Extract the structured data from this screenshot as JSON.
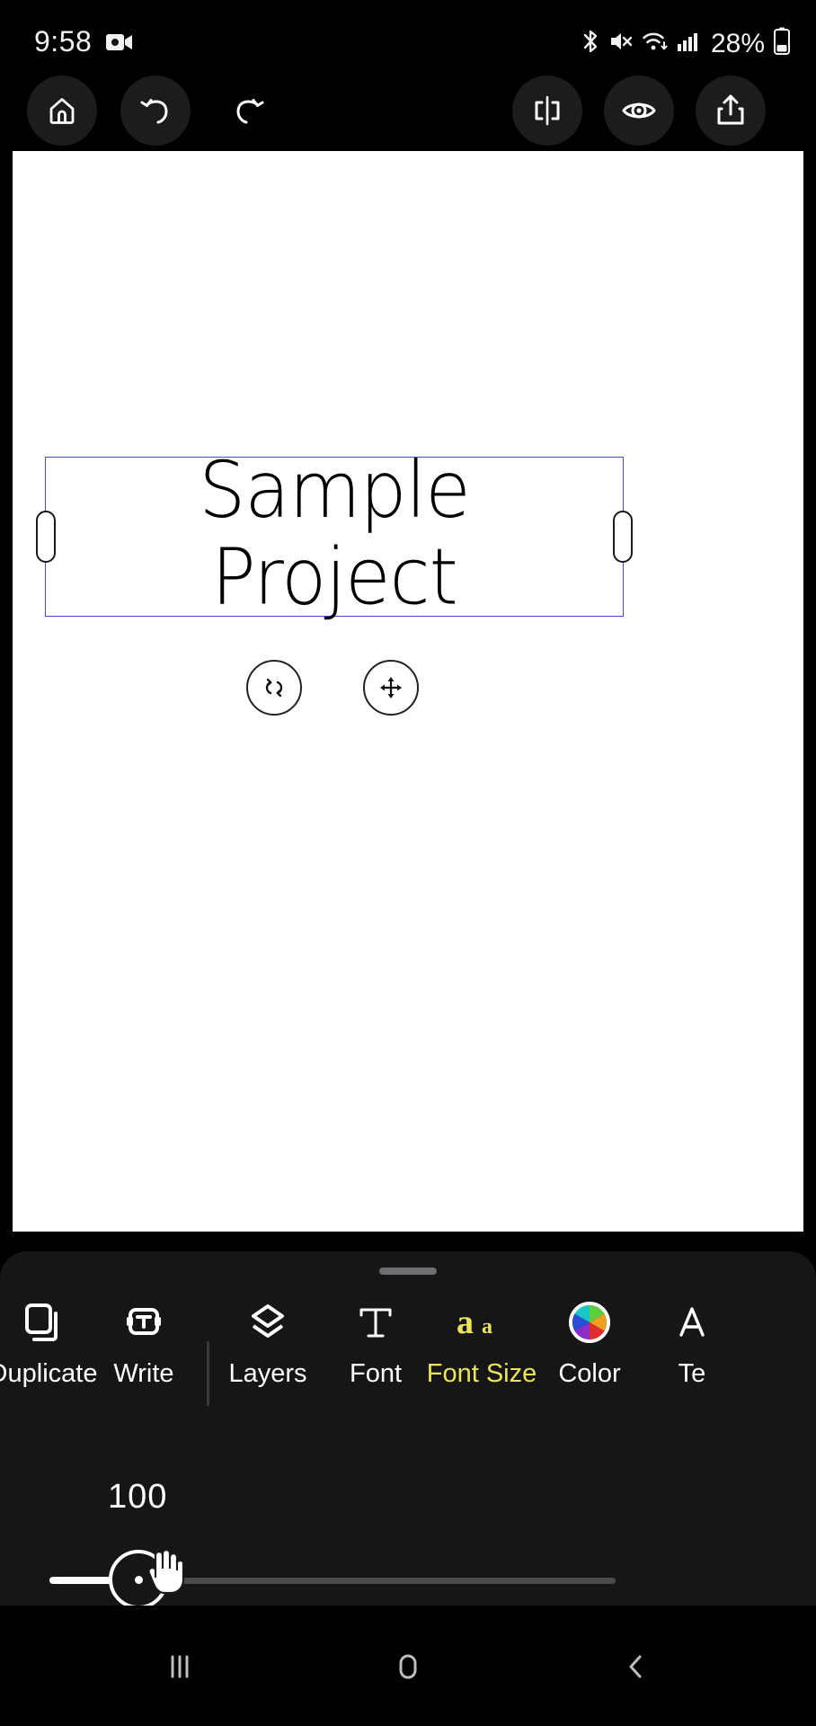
{
  "status_bar": {
    "time": "9:58",
    "battery_percent": "28%",
    "icons": [
      "screen-record-icon",
      "bluetooth-icon",
      "mute-icon",
      "wifi-icon",
      "cellular-signal-icon",
      "battery-icon"
    ]
  },
  "toolbar": {
    "buttons": [
      {
        "name": "home-button",
        "icon": "home-icon",
        "circled": true
      },
      {
        "name": "undo-button",
        "icon": "undo-icon",
        "circled": true
      },
      {
        "name": "redo-button",
        "icon": "redo-icon",
        "circled": false
      },
      {
        "name": "flip-button",
        "icon": "flip-horizontal-icon",
        "circled": true
      },
      {
        "name": "preview-button",
        "icon": "eye-icon",
        "circled": true
      },
      {
        "name": "share-button",
        "icon": "share-upload-icon",
        "circled": true
      }
    ]
  },
  "canvas": {
    "background_color": "#ffffff",
    "text_object": {
      "content": "Sample\nProject",
      "color": "#000000",
      "selected": true,
      "selection_border_color": "#4a4ad6"
    },
    "handles": {
      "rotate_icon": "rotate-icon",
      "move_icon": "move-icon",
      "resize_left": "resize-handle-left",
      "resize_right": "resize-handle-right"
    }
  },
  "bottom_panel": {
    "accent_color": "#ece55a",
    "tools": [
      {
        "label": "Duplicate",
        "icon": "duplicate-icon",
        "active": false
      },
      {
        "label": "Write",
        "icon": "write-text-icon",
        "active": false
      },
      {
        "label": "Layers",
        "icon": "layers-icon",
        "active": false
      },
      {
        "label": "Font",
        "icon": "font-icon",
        "active": false
      },
      {
        "label": "Font Size",
        "icon": "font-size-icon",
        "active": true
      },
      {
        "label": "Color",
        "icon": "color-wheel-icon",
        "active": false
      },
      {
        "label": "Te",
        "icon": "text-effect-icon",
        "active": false
      }
    ],
    "slider": {
      "value": "100",
      "min": 0,
      "max": 100,
      "fill_percent": 15
    }
  },
  "navigation_bar": {
    "buttons": [
      {
        "label": "recents",
        "icon": "recents-icon"
      },
      {
        "label": "home",
        "icon": "nav-home-icon"
      },
      {
        "label": "back",
        "icon": "back-icon"
      }
    ]
  }
}
